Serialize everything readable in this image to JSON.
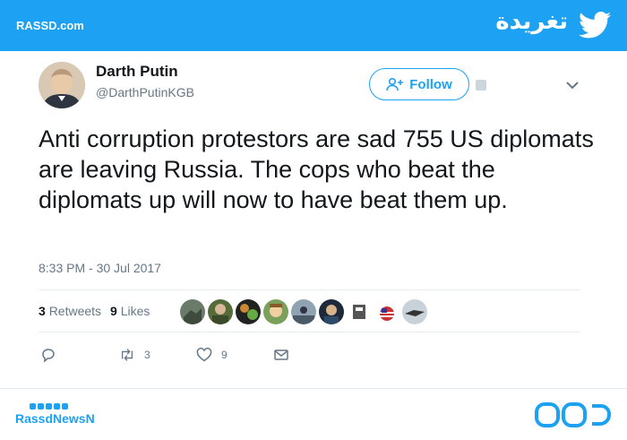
{
  "banner": {
    "brand": "RASSD.com",
    "title": "تغريدة",
    "icon": "twitter-bird-icon"
  },
  "tweet": {
    "author_name": "Darth Putin",
    "author_handle": "@DarthPutinKGB",
    "follow_label": "Follow",
    "text": "Anti corruption protestors are sad 755 US diplomats are leaving Russia. The cops who beat the diplomats up will now to have beat them up.",
    "timestamp": "8:33 PM - 30 Jul 2017",
    "retweets_count": "3",
    "retweets_label": "Retweets",
    "likes_count": "9",
    "likes_label": "Likes",
    "actions": {
      "reply_icon": "reply-icon",
      "retweet_icon": "retweet-icon",
      "retweet_count": "3",
      "like_icon": "heart-icon",
      "like_count": "9",
      "dm_icon": "envelope-icon"
    }
  },
  "footer": {
    "brand": "RassdNewsN",
    "social_icons": [
      "facebook-icon",
      "twitter-icon",
      "youtube-icon",
      "instagram-icon",
      "google-plus-icon"
    ]
  },
  "colors": {
    "accent": "#1da1f2",
    "text": "#14171a",
    "muted": "#657786"
  }
}
